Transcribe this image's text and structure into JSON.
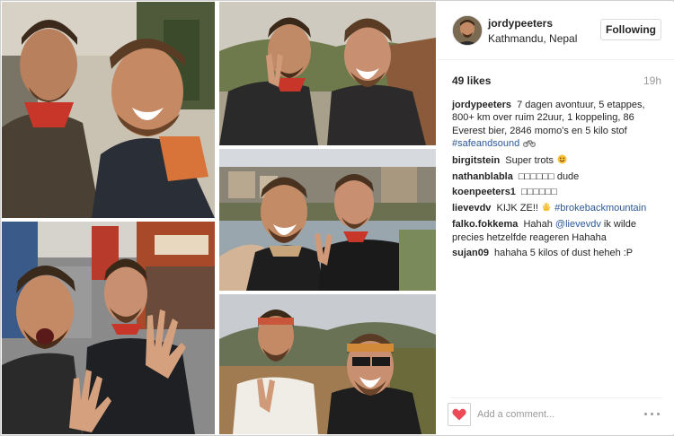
{
  "post": {
    "username": "jordypeeters",
    "location": "Kathmandu, Nepal",
    "follow_label": "Following",
    "likes": "49 likes",
    "timestamp": "19h"
  },
  "caption": {
    "user": "jordypeeters",
    "text": "7 dagen avontuur, 5 etappes, 800+ km over ruim 22uur, 1 koppeling, 86 Everest bier, 2846 momo's en 5 kilo stof",
    "hashtag": "#safeandsound"
  },
  "comments": [
    {
      "user": "birgitstein",
      "text": "Super trots"
    },
    {
      "user": "nathanblabla",
      "text": "□□□□□□ dude"
    },
    {
      "user": "koenpeeters1",
      "text": "□□□□□□"
    },
    {
      "user": "lievevdv",
      "text": "KIJK ZE!!",
      "hashtag": "#brokebackmountain"
    },
    {
      "user": "falko.fokkema",
      "text_pre": "Hahah",
      "mention": "@lievevdv",
      "text_post": "ik wilde precies hetzelfde reageren Hahaha"
    },
    {
      "user": "sujan09",
      "text": "hahaha 5 kilos of dust heheh :P"
    }
  ],
  "comment_box": {
    "placeholder": "Add a comment..."
  },
  "icons": {
    "like": "heart-icon",
    "liked_color": "#ed4956",
    "more": "more-options-icon",
    "motorcycle": "motorcycle-icon",
    "smile": "smiling-face-emoji",
    "hand": "waving-hand-emoji"
  },
  "colors": {
    "link": "#2b5797",
    "text": "#262626",
    "muted": "#999999"
  }
}
